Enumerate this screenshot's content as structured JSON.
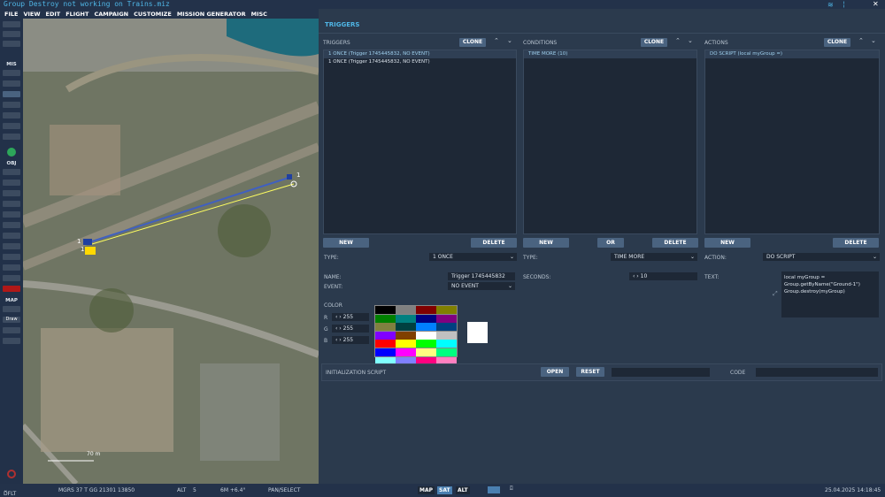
{
  "window": {
    "title": "Group Destroy not working on Trains.miz"
  },
  "menu": [
    "FILE",
    "VIEW",
    "EDIT",
    "FLIGHT",
    "CAMPAIGN",
    "CUSTOMIZE",
    "MISSION GENERATOR",
    "MISC"
  ],
  "toolbar": {
    "mis_label": "MIS",
    "obj_label": "OBJ",
    "map_label": "MAP",
    "draw_label": "Draw"
  },
  "map": {
    "unit_labels": [
      "1",
      "1",
      "1"
    ],
    "scale_label": "70 m"
  },
  "panel": {
    "title": "TRIGGERS",
    "triggers": {
      "header": "TRIGGERS",
      "clone": "CLONE",
      "items": [
        "1 ONCE (Trigger 1745445832, NO EVENT)",
        "1 ONCE (Trigger 1745445832, NO EVENT)"
      ],
      "new": "NEW",
      "delete": "DELETE",
      "type_label": "TYPE:",
      "type_value": "1 ONCE",
      "name_label": "NAME:",
      "name_value": "Trigger 1745445832",
      "event_label": "EVENT:",
      "event_value": "NO EVENT",
      "color_label": "COLOR",
      "r_label": "R",
      "g_label": "G",
      "b_label": "B",
      "r": "255",
      "g": "255",
      "b": "255"
    },
    "conditions": {
      "header": "CONDITIONS",
      "clone": "CLONE",
      "items": [
        "TIME MORE (10)"
      ],
      "new": "NEW",
      "or": "OR",
      "delete": "DELETE",
      "type_label": "TYPE:",
      "type_value": "TIME MORE",
      "seconds_label": "SECONDS:",
      "seconds_value": "10"
    },
    "actions": {
      "header": "ACTIONS",
      "clone": "CLONE",
      "items": [
        "DO SCRIPT (local myGroup =)"
      ],
      "new": "NEW",
      "delete": "DELETE",
      "action_label": "ACTION:",
      "action_value": "DO SCRIPT",
      "text_label": "TEXT:",
      "text_value": "local myGroup = Group.getByName(\"Ground-1\")\nGroup.destroy(myGroup)"
    },
    "init": {
      "label": "INITIALIZATION SCRIPT",
      "open": "OPEN",
      "reset": "RESET",
      "code_label": "CODE"
    },
    "palette": [
      "#000000",
      "#808080",
      "#800000",
      "#808000",
      "#008000",
      "#008080",
      "#000080",
      "#800080",
      "#808040",
      "#004040",
      "#0080ff",
      "#004080",
      "#8000ff",
      "#804000",
      "#ffffff",
      "#c0c0c0",
      "#ff0000",
      "#ffff00",
      "#00ff00",
      "#00ffff",
      "#0000ff",
      "#ff00ff",
      "#ffff80",
      "#00ff80",
      "#80ffff",
      "#8080ff",
      "#ff0080",
      "#ff80c0"
    ],
    "selected_color": "#ffffff"
  },
  "status": {
    "profile": "DFLT",
    "coords": "MGRS  37 T GG 21301 13850",
    "alt_label": "ALT",
    "alt": "5",
    "mag": "6M  +6.4°",
    "mode": "PAN/SELECT",
    "map_btn": "MAP",
    "sat_btn": "SAT",
    "alt_btn": "ALT",
    "datetime": "25.04.2025 14:18:45"
  }
}
